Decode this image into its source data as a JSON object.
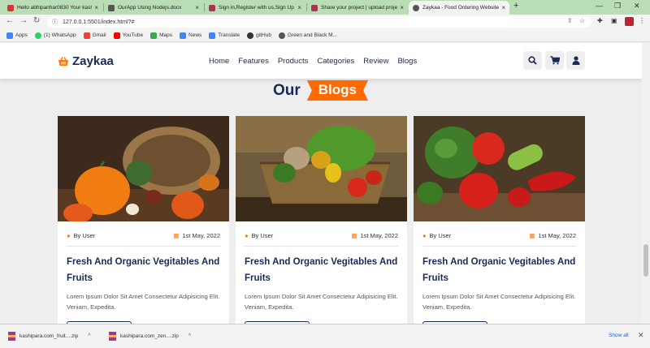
{
  "browser": {
    "tabs": [
      {
        "label": "Hello abhipanhar0830 Your kashi",
        "color": "#d33"
      },
      {
        "label": "OurApp Using Nodejs.docx",
        "color": "#555"
      },
      {
        "label": "Sign in,Register with us,Sign Up",
        "color": "#a35"
      },
      {
        "label": "Share your project | upload proje",
        "color": "#a35"
      },
      {
        "label": "Zaykaa - Food Ordering Website",
        "color": "#555"
      }
    ],
    "url": "127.0.0.1:5501/index.html?#",
    "bookmarks": [
      {
        "label": "Apps",
        "color": "#4285f4"
      },
      {
        "label": "(1) WhatsApp",
        "color": "#25d366"
      },
      {
        "label": "Gmail",
        "color": "#ea4335"
      },
      {
        "label": "YouTube",
        "color": "#ff0000"
      },
      {
        "label": "Maps",
        "color": "#34a853"
      },
      {
        "label": "News",
        "color": "#4285f4"
      },
      {
        "label": "Translate",
        "color": "#4285f4"
      },
      {
        "label": "gitHub",
        "color": "#333333"
      },
      {
        "label": "Green and Black M...",
        "color": "#555555"
      }
    ]
  },
  "site": {
    "brand": "Zaykaa",
    "nav": [
      "Home",
      "Features",
      "Products",
      "Categories",
      "Review",
      "Blogs"
    ],
    "section_heading_1": "Our",
    "section_heading_2": "Blogs",
    "accent": "#ff6b00",
    "navy": "#192a56"
  },
  "blogs": [
    {
      "author": "By User",
      "date": "1st May, 2022",
      "title": "Fresh And Organic Vegitables And Fruits",
      "desc": "Lorem Ipsum Dolor Sit Amet Consectetur Adipisicing Elit. Veniam, Expedita."
    },
    {
      "author": "By User",
      "date": "1st May, 2022",
      "title": "Fresh And Organic Vegitables And Fruits",
      "desc": "Lorem Ipsum Dolor Sit Amet Consectetur Adipisicing Elit. Veniam, Expedita."
    },
    {
      "author": "By User",
      "date": "1st May, 2022",
      "title": "Fresh And Organic Vegitables And Fruits",
      "desc": "Lorem Ipsum Dolor Sit Amet Consectetur Adipisicing Elit. Veniam, Expedita."
    }
  ],
  "downloads": {
    "items": [
      "kashipara.com_fruit....zip",
      "kashipara.com_zen....zip"
    ],
    "show_all": "Show all"
  }
}
